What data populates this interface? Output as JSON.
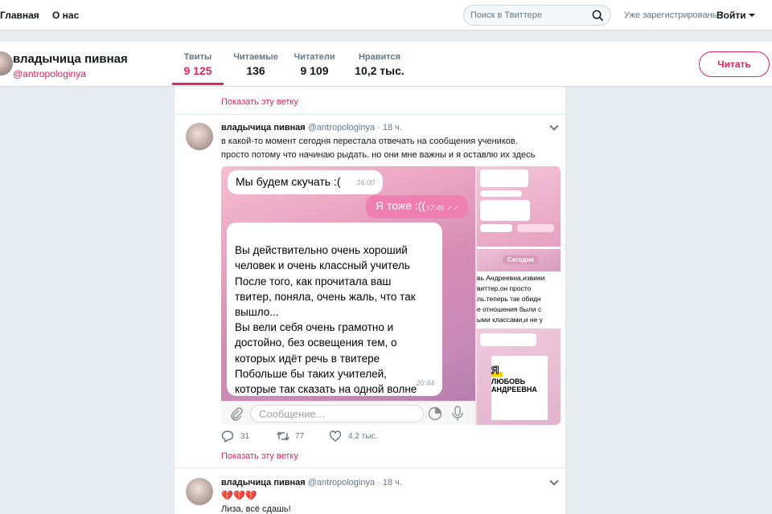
{
  "nav": {
    "home": "Главная",
    "about": "О нас",
    "search_placeholder": "Поиск в Твиттере",
    "login_question": "Уже зарегистрированы?",
    "login": "Войти"
  },
  "profile": {
    "name": "владычица пивная",
    "handle": "@antropologinya",
    "follow_label": "Читать",
    "stats": [
      {
        "label": "Твиты",
        "value": "9 125"
      },
      {
        "label": "Читаемые",
        "value": "136"
      },
      {
        "label": "Читатели",
        "value": "9 109"
      },
      {
        "label": "Нравится",
        "value": "10,2 тыс."
      }
    ]
  },
  "colors": {
    "accent": "#e0245e",
    "chat_bubble_out": "#ef7fb0"
  },
  "timeline": {
    "show_thread_top": "Показать эту ветку",
    "tweet1": {
      "name": "владычица пивная",
      "handle": "@antropologinya",
      "time": "· 18 ч.",
      "text_line1": "в какой-то момент сегодня перестала отвечать на сообщения учеников.",
      "text_line2": "просто потому что начинаю рыдать. но они мне важны и я оставлю их здесь",
      "media": {
        "msg1": "Мы будем скучать :(",
        "msg1_time": "16:00",
        "msg2": "Я тоже :((",
        "msg2_time": "17:46 ✓✓",
        "msg3": "Вы  действительно очень хороший\nчеловек и очень классный  учитель\nПосле того, как прочитала ваш\nтвитер, поняла, очень жаль, что так\nвышло...\nВы вели себя очень грамотно и\nдостойно, без освещения тем, о\nкоторых идёт речь в твитере\nПобольше бы таких учителей,\nкоторые так сказать на одной волне\nс учениками",
        "msg3_time": "20:44",
        "input_placeholder": "Сообщение...",
        "today_chip": "Сегодня",
        "side_text": "вь Андреевна,извини\nвиттер.он просто\nль.теперь так обидн\nе отношения были с\nыми классами,и не у",
        "card_ya": "Я",
        "card_name": "ЛЮБОВЬ\nАНДРЕЕВНА"
      },
      "replies": "31",
      "retweets": "77",
      "likes": "4,2 тыс."
    },
    "show_thread": "Показать эту ветку",
    "tweet2": {
      "name": "владычица пивная",
      "handle": "@antropologinya",
      "time": "· 18 ч.",
      "emoji": "💔💔💔",
      "text": "Лиза, всё сдашь!"
    }
  }
}
